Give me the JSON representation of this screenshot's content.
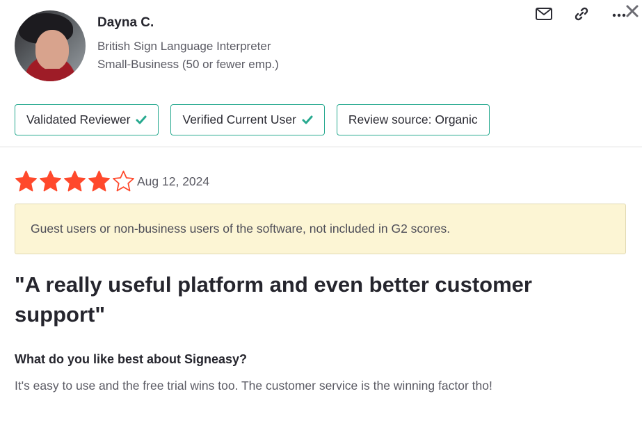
{
  "reviewer": {
    "name": "Dayna C.",
    "title": "British Sign Language Interpreter",
    "company_size": "Small-Business (50 or fewer emp.)"
  },
  "icons": {
    "mail": "mail-icon",
    "link": "link-icon",
    "more": "more-icon",
    "close": "close-icon",
    "check": "check-icon",
    "star": "star-icon"
  },
  "badges": [
    {
      "label": "Validated Reviewer",
      "checked": true
    },
    {
      "label": "Verified Current User",
      "checked": true
    },
    {
      "label": "Review source: Organic",
      "checked": false
    }
  ],
  "rating": {
    "value": 4,
    "max": 5
  },
  "review": {
    "date": "Aug 12, 2024",
    "notice": "Guest users or non-business users of the software, not included in G2 scores.",
    "title": "\"A really useful platform and even better customer support\"",
    "question": "What do you like best about Signeasy?",
    "answer": "It's easy to use and the free trial wins too. The customer service is the winning factor tho!"
  },
  "colors": {
    "accent": "#27a98f",
    "star_fill": "#ff492c",
    "notice_bg": "#fcf5d4"
  }
}
